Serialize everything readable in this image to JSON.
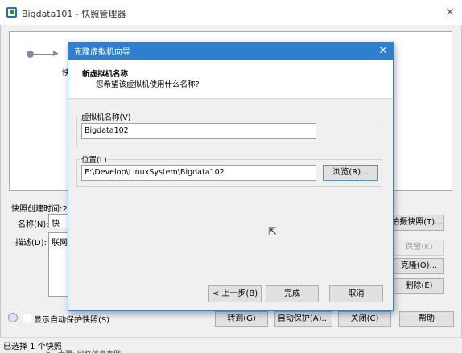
{
  "window": {
    "title": "Bigdata101 - 快照管理器",
    "close_glyph": "×"
  },
  "behind": {
    "partial_text_1": "快",
    "snapshot_time_label": "快照创建时间:2",
    "name_label": "名称(N):",
    "name_value_partial": "快",
    "desc_label": "描述(D):",
    "desc_value_partial": "联网",
    "autoprotect_checkbox_label": "显示自动保护快照(S)",
    "right_buttons": {
      "take_snapshot": "拍摄快照(T)...",
      "keep": "保留(K)",
      "clone": "克隆(O)...",
      "delete": "删除(E)"
    },
    "bottom_buttons": {
      "goto": "转到(G)",
      "autoprotect": "自动保护(A)...",
      "close": "关闭(C)",
      "help": "帮助"
    },
    "status": "已选择 1 个快照",
    "status_below": "上一步骤: 网络信息事例"
  },
  "dialog": {
    "title": "克隆虚拟机向导",
    "close_glyph": "✕",
    "header_title": "新虚拟机名称",
    "header_subtitle": "您希望该虚拟机使用什么名称?",
    "name_group_label": "虚拟机名称(V)",
    "name_value": "Bigdata102",
    "location_group_label": "位置(L)",
    "location_value": "E:\\Develop\\LinuxSystem\\Bigdata102",
    "browse_button": "浏览(R)...",
    "back_button": "< 上一步(B)",
    "finish_button": "完成",
    "cancel_button": "取消"
  }
}
